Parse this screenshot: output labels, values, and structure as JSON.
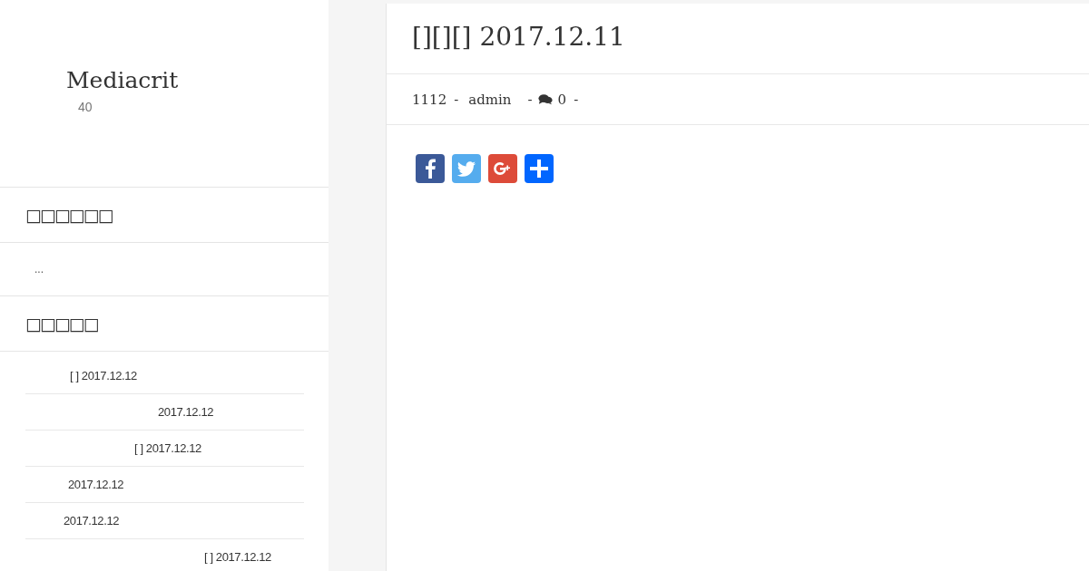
{
  "site": {
    "title": "Mediacrit",
    "subtitle": "40"
  },
  "widgets": [
    {
      "heading": "□□□□□□",
      "text": "..."
    },
    {
      "heading": "□□□□□",
      "posts": [
        "[ ] 2017.12.12",
        "2017.12.12",
        "[ ] 2017.12.12",
        "2017.12.12",
        "2017.12.12",
        "[ ] 2017.12.12"
      ]
    }
  ],
  "post": {
    "title": "[][][] 2017.12.11",
    "date": "1112",
    "author": "admin",
    "comments": "0",
    "separators": [
      "-",
      "-",
      "-"
    ],
    "share": [
      {
        "kind": "facebook"
      },
      {
        "kind": "twitter"
      },
      {
        "kind": "google-plus"
      },
      {
        "kind": "share"
      }
    ]
  }
}
